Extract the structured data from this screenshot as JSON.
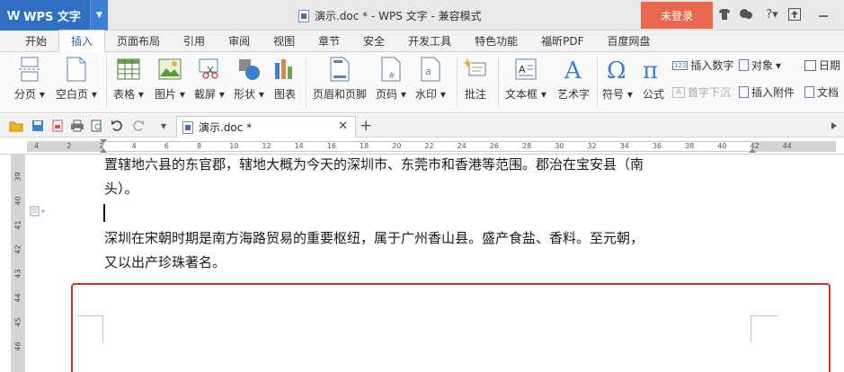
{
  "app": {
    "menu_label": "WPS 文字",
    "window_title": "演示.doc * - WPS 文字 - 兼容模式",
    "login_label": "未登录"
  },
  "tabs": [
    "开始",
    "插入",
    "页面布局",
    "引用",
    "审阅",
    "视图",
    "章节",
    "安全",
    "开发工具",
    "特色功能",
    "福昕PDF",
    "百度网盘"
  ],
  "active_tab": "插入",
  "ribbon": {
    "page_break": "分页",
    "blank_page": "空白页",
    "table": "表格",
    "picture": "图片",
    "screenshot": "截屏",
    "shape": "形状",
    "chart": "图表",
    "header_footer": "页眉和页脚",
    "page_number": "页码",
    "watermark": "水印",
    "comment": "批注",
    "textbox": "文本框",
    "art_text": "艺术字",
    "symbol": "符号",
    "formula": "公式",
    "insert_number": "插入数字",
    "drop_cap": "首字下沉",
    "object": "对象",
    "insert_attachment": "插入附件",
    "date": "日期",
    "document": "文档"
  },
  "doc_tab": {
    "name": "演示.doc *"
  },
  "ruler": {
    "h_marks": [
      "4",
      "2",
      "2",
      "4",
      "6",
      "8",
      "10",
      "12",
      "14",
      "16",
      "18",
      "20",
      "22",
      "24",
      "26",
      "28",
      "30",
      "32",
      "34",
      "36",
      "38",
      "40",
      "42",
      "44"
    ],
    "v_marks": [
      "39",
      "40",
      "41",
      "42",
      "43",
      "44",
      "45",
      "46"
    ]
  },
  "document": {
    "line1": "置辖地六县的东官郡，辖地大概为今天的深圳市、东莞市和香港等范围。郡治在宝安县（南",
    "line2": "头）。",
    "line3": "深圳在宋朝时期是南方海路贸易的重要枢纽，属于广州香山县。盛产食盐、香料。至元朝，",
    "line4": "又以出产珍珠著名。"
  },
  "colors": {
    "wps_blue": "#2e6fc4",
    "login_red": "#e8674e",
    "highlight_red": "#d8302a"
  }
}
